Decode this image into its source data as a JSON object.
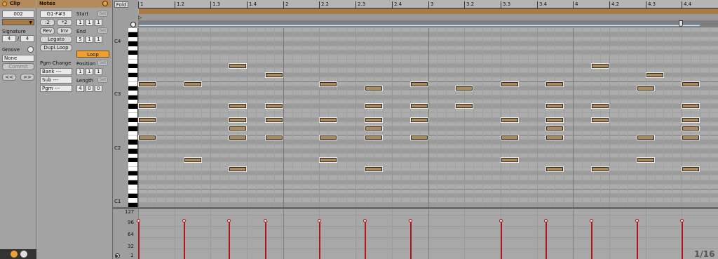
{
  "clip": {
    "title": "Clip",
    "name": "002",
    "signature_label": "Signature",
    "sig_num": "4",
    "sig_den": "4",
    "sig_sep": "/",
    "groove_label": "Groove",
    "groove_value": "None",
    "commit_label": "Commit",
    "prev_label": "<<",
    "next_label": ">>"
  },
  "notes": {
    "title": "Notes",
    "range": "G1-F#3",
    "half_label": ":2",
    "double_label": "*2",
    "rev_label": "Rev",
    "inv_label": "Inv",
    "legato_label": "Legato",
    "dupl_label": "Dupl.Loop",
    "pgm_change_label": "Pgm Change",
    "bank_label": "Bank ---",
    "sub_label": "Sub ---",
    "pgm_label": "Pgm ---"
  },
  "loop": {
    "start_label": "Start",
    "start": [
      "1",
      "1",
      "1"
    ],
    "end_label": "End",
    "end": [
      "5",
      "1",
      "1"
    ],
    "loop_label": "Loop",
    "position_label": "Position",
    "position": [
      "1",
      "1",
      "1"
    ],
    "length_label": "Length",
    "length": [
      "4",
      "0",
      "0"
    ],
    "set_label": "Set"
  },
  "editor": {
    "fold_label": "Fold",
    "ruler": [
      "1",
      "1.2",
      "1.3",
      "1.4",
      "2",
      "2.2",
      "2.3",
      "2.4",
      "3",
      "3.2",
      "3.3",
      "3.4",
      "4",
      "4.2",
      "4.3",
      "4.4"
    ],
    "octaves": [
      "C4",
      "C3",
      "C2",
      "C1"
    ],
    "velocity_ticks": [
      "127",
      "96",
      "64",
      "32",
      "1"
    ],
    "grid_label": "1/16",
    "colors": {
      "accent": "#b58a5a",
      "note": "#a88a62",
      "velocity": "#b0141d",
      "loop_orange": "#f0a030"
    }
  }
}
